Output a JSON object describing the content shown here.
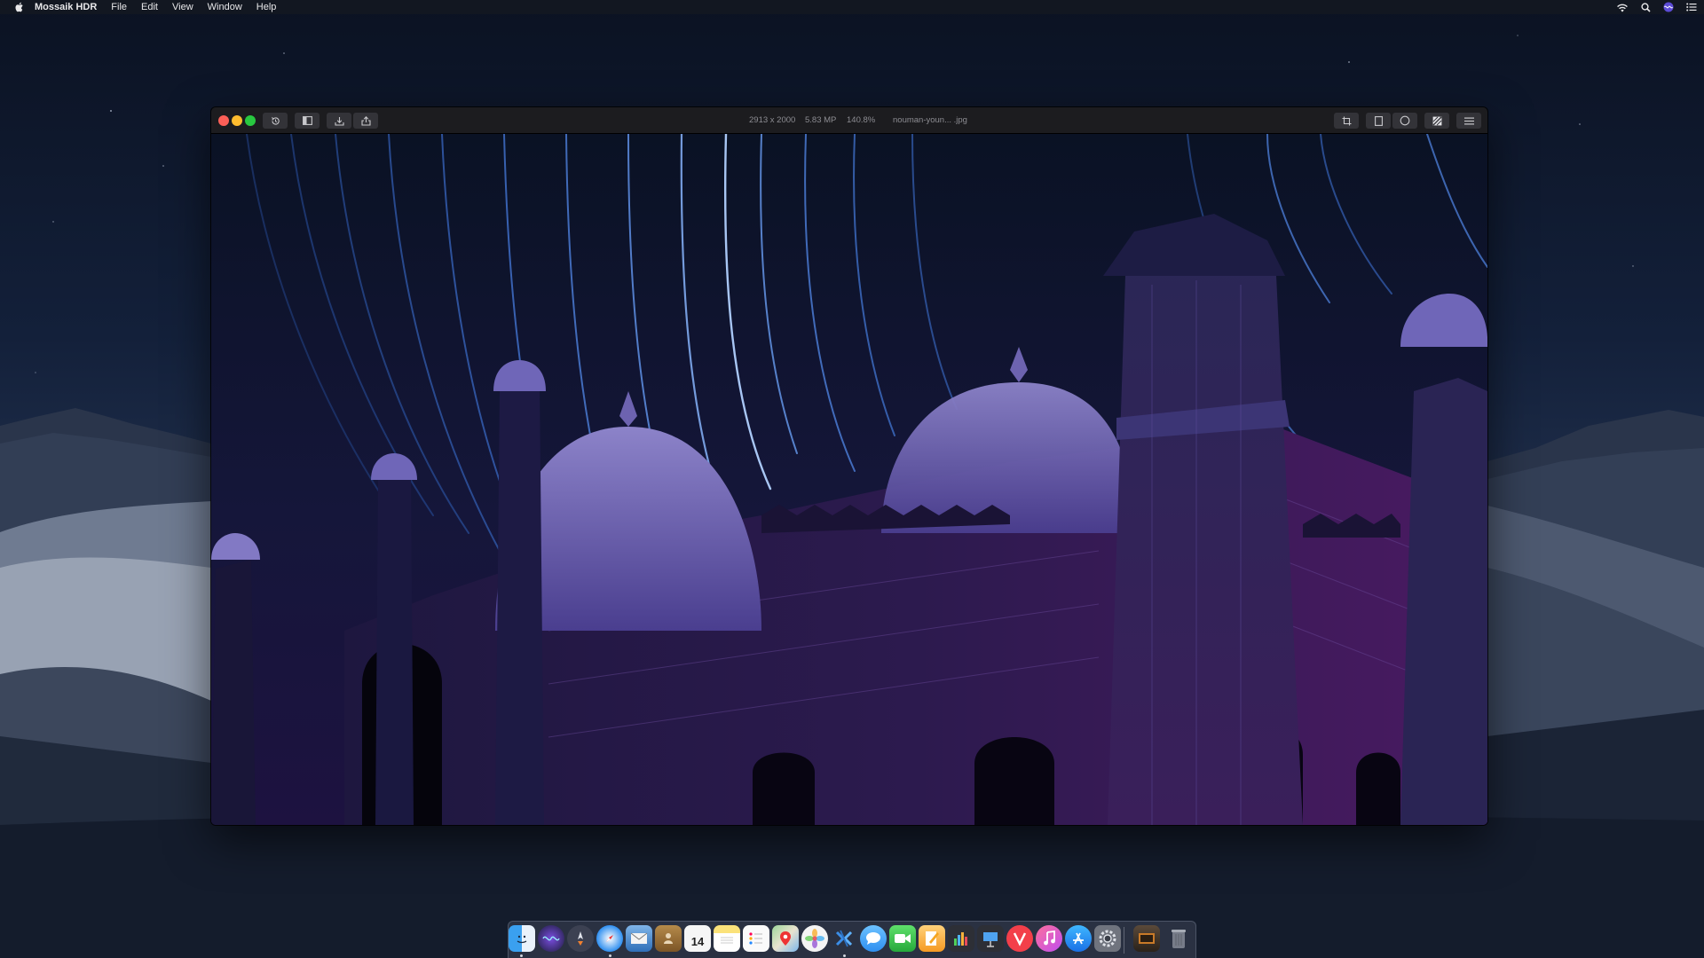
{
  "menubar": {
    "app_name": "Mossaik HDR",
    "menus": [
      "File",
      "Edit",
      "View",
      "Window",
      "Help"
    ],
    "status_icons": [
      "wifi-icon",
      "spotlight-search-icon",
      "siri-icon",
      "notification-center-icon"
    ]
  },
  "window": {
    "toolbar_left": [
      "history-icon",
      "sidebar-icon",
      "import-icon",
      "share-icon"
    ],
    "image_info": {
      "dimensions": "2913 x 2000",
      "megapixels": "5.83 MP",
      "zoom": "140.8%",
      "filename": "nouman-youn... .jpg"
    },
    "toolbar_right": [
      "crop-icon",
      "frame-icon",
      "circle-icon",
      "compare-icon",
      "menu-icon"
    ]
  },
  "dock": {
    "apps": [
      {
        "name": "Finder",
        "icon": "finder-icon",
        "running": true
      },
      {
        "name": "Siri",
        "icon": "siri-icon",
        "running": false
      },
      {
        "name": "Launchpad",
        "icon": "launchpad-icon",
        "running": false
      },
      {
        "name": "Safari",
        "icon": "safari-icon",
        "running": true
      },
      {
        "name": "Mail",
        "icon": "mail-icon",
        "running": false
      },
      {
        "name": "Contacts",
        "icon": "contacts-icon",
        "running": false
      },
      {
        "name": "Calendar",
        "icon": "calendar-icon",
        "running": false,
        "date": "14"
      },
      {
        "name": "Notes",
        "icon": "notes-icon",
        "running": false
      },
      {
        "name": "Reminders",
        "icon": "reminders-icon",
        "running": false
      },
      {
        "name": "Maps",
        "icon": "maps-icon",
        "running": false
      },
      {
        "name": "Photos",
        "icon": "photos-icon",
        "running": false
      },
      {
        "name": "Mossaik HDR",
        "icon": "mossaik-hdr-icon",
        "running": true
      },
      {
        "name": "Messages",
        "icon": "messages-icon",
        "running": false
      },
      {
        "name": "FaceTime",
        "icon": "facetime-icon",
        "running": false
      },
      {
        "name": "Pages",
        "icon": "pages-icon",
        "running": false
      },
      {
        "name": "Numbers",
        "icon": "numbers-icon",
        "running": false
      },
      {
        "name": "Keynote",
        "icon": "keynote-icon",
        "running": false
      },
      {
        "name": "News",
        "icon": "news-icon",
        "running": false
      },
      {
        "name": "iTunes",
        "icon": "itunes-icon",
        "running": false
      },
      {
        "name": "App Store",
        "icon": "app-store-icon",
        "running": false
      },
      {
        "name": "System Preferences",
        "icon": "system-preferences-icon",
        "running": false
      }
    ],
    "others": [
      {
        "name": "Downloads",
        "icon": "downloads-stack-icon"
      },
      {
        "name": "Trash",
        "icon": "trash-icon"
      }
    ]
  },
  "colors": {
    "close": "#fc5f57",
    "minimize": "#febc2e",
    "zoom": "#28c840",
    "window_toolbar": "#1c1c1f",
    "image_tint": "#3b2f7a"
  }
}
